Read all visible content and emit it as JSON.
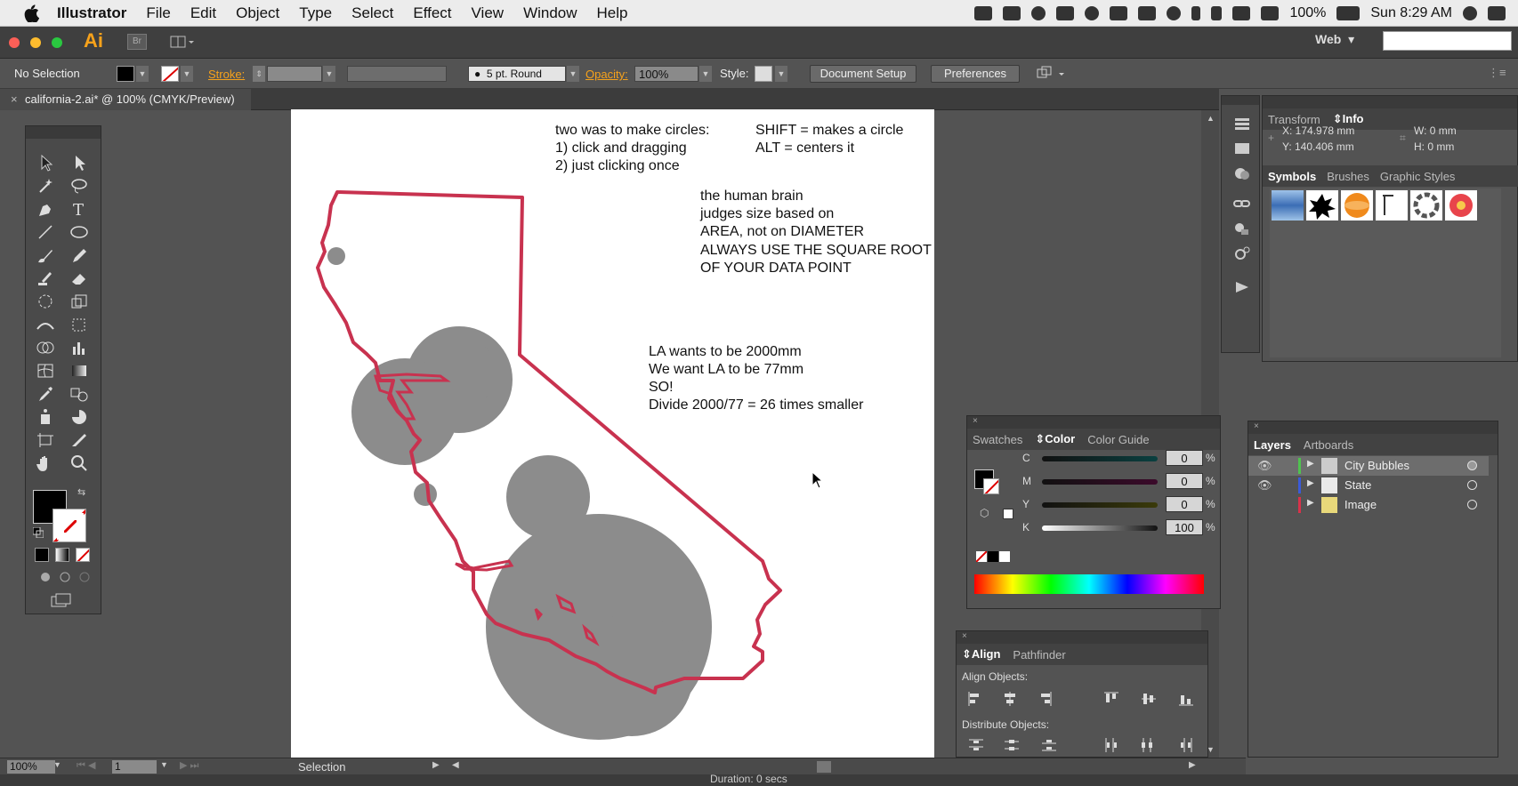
{
  "menubar": {
    "app": "Illustrator",
    "items": [
      "File",
      "Edit",
      "Object",
      "Type",
      "Select",
      "Effect",
      "View",
      "Window",
      "Help"
    ],
    "battery": "100%",
    "clock": "Sun 8:29 AM"
  },
  "appbar": {
    "logo": "Ai",
    "bridge": "Br",
    "workspace": "Web",
    "workspace_arrow": "▾"
  },
  "control": {
    "selection": "No Selection",
    "stroke_label": "Stroke:",
    "brush": "5 pt. Round",
    "opacity_label": "Opacity:",
    "opacity_value": "100%",
    "style_label": "Style:",
    "document_setup": "Document Setup",
    "preferences": "Preferences"
  },
  "document": {
    "tab_title": "california-2.ai* @ 100% (CMYK/Preview)"
  },
  "artboard_notes": {
    "line1": "two was to make circles:",
    "line2": "1) click and dragging",
    "line3": "2) just clicking once",
    "shift": "SHIFT = makes a circle",
    "alt": "ALT = centers it",
    "brain1": "the human brain",
    "brain2": "judges size based on",
    "brain3": "AREA, not on DIAMETER",
    "brain4": "ALWAYS USE THE SQUARE ROOT",
    "brain5": "OF YOUR DATA POINT",
    "la1": "LA wants to be 2000mm",
    "la2": "We want LA to be 77mm",
    "la3": "SO!",
    "la4": "Divide 2000/77 = 26 times smaller"
  },
  "info_panel": {
    "tabs": [
      "Transform",
      "Info"
    ],
    "x": "X: 174.978 mm",
    "y": "Y: 140.406 mm",
    "w": "W: 0 mm",
    "h": "H: 0 mm"
  },
  "symbols_panel": {
    "tabs": [
      "Symbols",
      "Brushes",
      "Graphic Styles"
    ]
  },
  "color_panel": {
    "tabs": [
      "Swatches",
      "Color",
      "Color Guide"
    ],
    "channels": [
      {
        "label": "C",
        "value": "0",
        "unit": "%"
      },
      {
        "label": "M",
        "value": "0",
        "unit": "%"
      },
      {
        "label": "Y",
        "value": "0",
        "unit": "%"
      },
      {
        "label": "K",
        "value": "100",
        "unit": "%"
      }
    ]
  },
  "align_panel": {
    "tabs": [
      "Align",
      "Pathfinder"
    ],
    "align_objects": "Align Objects:",
    "distribute_objects": "Distribute Objects:"
  },
  "layers_panel": {
    "tabs": [
      "Layers",
      "Artboards"
    ],
    "layers": [
      {
        "name": "City Bubbles",
        "color": "#4fc24f"
      },
      {
        "name": "State",
        "color": "#3b5bd8"
      },
      {
        "name": "Image",
        "color": "#d8324a"
      }
    ]
  },
  "status": {
    "zoom": "100%",
    "artboard": "1",
    "tool": "Selection",
    "duration": "Duration: 0 secs"
  },
  "colors": {
    "state_outline": "#c8324f",
    "bubble": "#8c8c8c",
    "accent": "#f7a21b"
  }
}
